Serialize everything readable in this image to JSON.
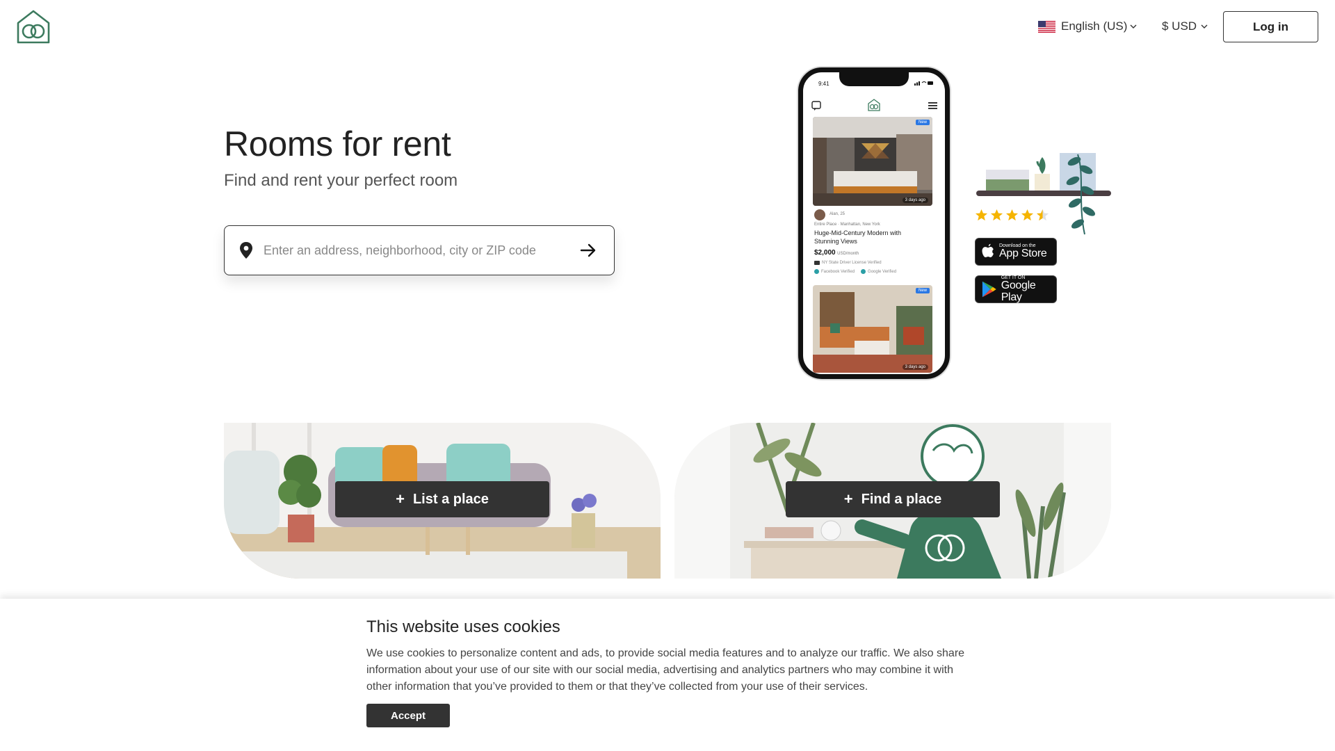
{
  "header": {
    "logo_icon": "house-heart-logo-icon",
    "language_label": "English (US)",
    "currency_label": "$ USD",
    "login_label": "Log in"
  },
  "hero": {
    "title": "Rooms for rent",
    "subtitle": "Find and rent your perfect room",
    "search_placeholder": "Enter an address, neighborhood, city or ZIP code"
  },
  "phone_preview": {
    "time": "9:41",
    "badge_new": "New",
    "days_ago": "3 days ago",
    "host": "Alan, 25",
    "location": "Entire Place · Manhattan, New York",
    "listing_title": "Huge-Mid-Century Modern  with Stunning Views",
    "price": "$2,000",
    "price_unit": "USD/month",
    "verify_license": "NY State Driver License Verified",
    "verify_facebook": "Facebook Verified",
    "verify_google": "Google Verified",
    "badge_new_2": "New",
    "days_ago_2": "3 days ago"
  },
  "rating": {
    "value": 4.5,
    "max": 5
  },
  "app_store": {
    "small": "Download on the",
    "big": "App Store"
  },
  "google_play": {
    "small": "GET IT ON",
    "big": "Google Play"
  },
  "cards": {
    "list_label": "List a place",
    "find_label": "Find a place"
  },
  "cookie": {
    "title": "This website uses cookies",
    "text": "We use cookies to personalize content and ads, to provide social media features and to analyze our traffic. We also share information about your use of our site with our social media, advertising and analytics partners who may combine it with other information that you’ve provided to them or that they’ve collected from your use of their services.",
    "accept_label": "Accept"
  },
  "colors": {
    "brand_green": "#3c7a5e",
    "dark_button": "#333333",
    "star": "#f5b400"
  }
}
